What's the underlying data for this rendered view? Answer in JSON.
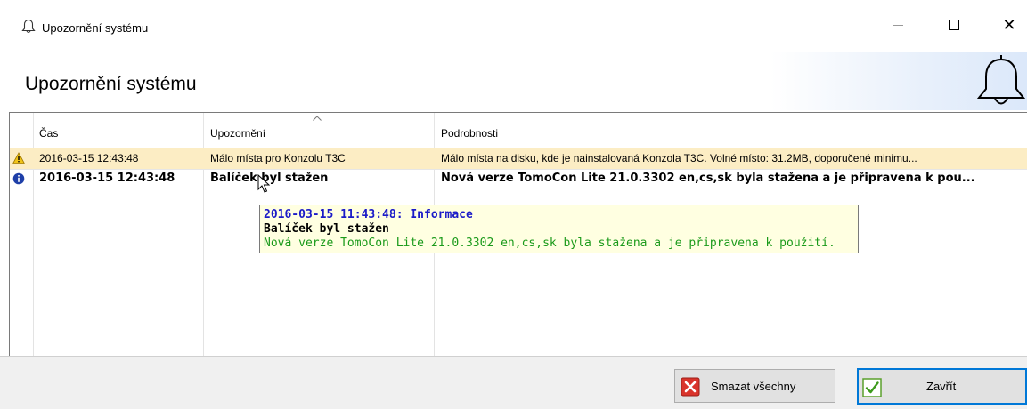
{
  "window": {
    "title": "Upozornění systému",
    "icon": "bell-icon",
    "controls": [
      "minimize-icon",
      "maximize-icon",
      "close-icon"
    ],
    "close_glyph": "✕"
  },
  "header": {
    "title": "Upozornění systému",
    "icon": "bell-icon"
  },
  "grid": {
    "columns": [
      {
        "key": "time",
        "label": "Čas"
      },
      {
        "key": "notice",
        "label": "Upozornění"
      },
      {
        "key": "details",
        "label": "Podrobnosti"
      }
    ],
    "sort_icon": "sort-up-icon",
    "rows": [
      {
        "type": "warning",
        "icon": "warning-icon",
        "time": "2016-03-15 12:43:48",
        "notice": "Málo místa pro Konzolu T3C",
        "details": "Málo místa na disku, kde je nainstalovaná Konzola T3C. Volné místo: 31.2MB, doporučené minimu..."
      },
      {
        "type": "info",
        "icon": "info-icon",
        "time": "2016-03-15 12:43:48",
        "notice": "Balíček byl stažen",
        "details": "Nová verze TomoCon Lite 21.0.3302 en,cs,sk byla stažena a je připravena k pou..."
      }
    ],
    "empty_rows": 7
  },
  "tooltip": {
    "line1": "2016-03-15 11:43:48: Informace",
    "line2": "Balíček byl stažen",
    "line3": "Nová verze TomoCon Lite 21.0.3302 en,cs,sk byla stažena a je připravena k použití."
  },
  "footer": {
    "clear_label": "Smazat všechny",
    "clear_icon": "red-x-icon",
    "close_label": "Zavřít",
    "close_icon": "green-check-icon"
  },
  "colors": {
    "warning_row_bg": "#fcedc4",
    "tooltip_bg": "#ffffe1",
    "tooltip_title": "#1b1bc8",
    "tooltip_detail": "#1a9a1a",
    "focus_border": "#0078d7"
  }
}
